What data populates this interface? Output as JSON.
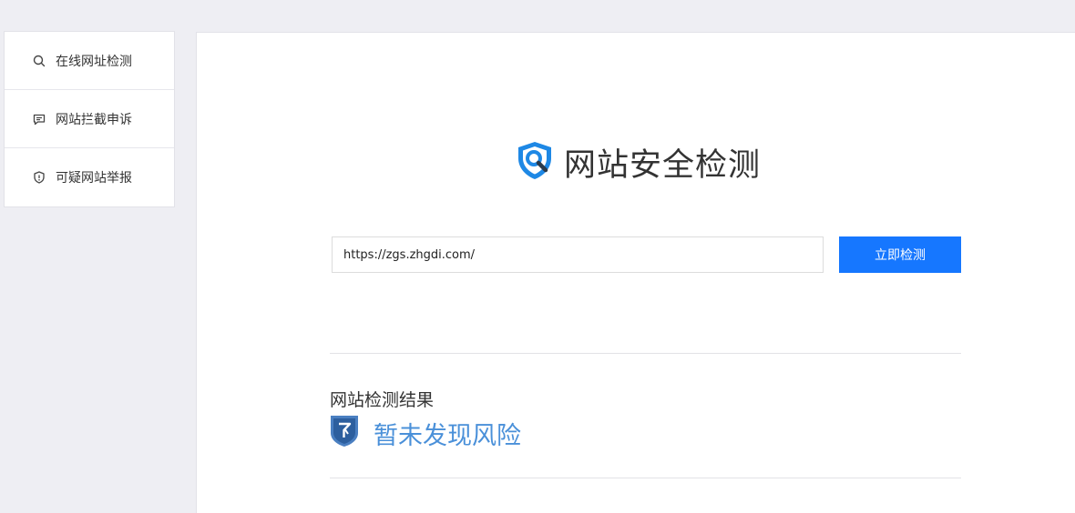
{
  "sidebar": {
    "items": [
      {
        "label": "在线网址检测",
        "icon": "search-icon"
      },
      {
        "label": "网站拦截申诉",
        "icon": "chat-icon"
      },
      {
        "label": "可疑网站举报",
        "icon": "shield-alert-icon"
      }
    ]
  },
  "logo": {
    "title": "网站安全检测"
  },
  "search": {
    "value": "https://zgs.zhgdi.com/",
    "button_label": "立即检测"
  },
  "result": {
    "heading": "网站检测结果",
    "status": "暂未发现风险"
  },
  "colors": {
    "primary": "#1677ff",
    "result": "#4a90d9",
    "logo_blue": "#1e88e5"
  }
}
